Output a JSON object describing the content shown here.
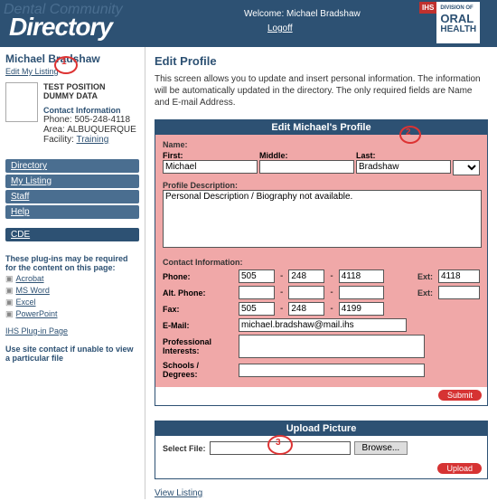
{
  "header": {
    "bg_text": "Dental Community",
    "title": "Directory",
    "welcome": "Welcome: Michael Bradshaw",
    "logoff": "Logoff",
    "logo": {
      "ihs": "IHS",
      "division": "DIVISION OF",
      "oral": "ORAL",
      "health": "HEALTH"
    }
  },
  "sidebar": {
    "name": "Michael Bradshaw",
    "edit_link": "Edit My Listing",
    "card": {
      "line1": "TEST POSITION",
      "line2": "DUMMY DATA",
      "contact_hdr": "Contact Information",
      "phone": "Phone: 505-248-4118",
      "area": "Area: ALBUQUERQUE",
      "facility_label": "Facility:",
      "facility_link": "Training"
    },
    "nav": [
      "Directory",
      "My Listing",
      "Staff",
      "Help"
    ],
    "cde": "CDE",
    "plugins_intro": "These plug-ins may be required for the content on this page:",
    "plugins": [
      "Acrobat",
      "MS Word",
      "Excel",
      "PowerPoint"
    ],
    "plugin_page": "IHS Plug-in Page",
    "nosite": "Use site contact if unable to view a particular file"
  },
  "main": {
    "heading": "Edit Profile",
    "intro": "This screen allows you to update and insert personal information. The information will be automatically updated in the directory. The only required fields are Name and E-mail Address.",
    "panel_title": "Edit Michael's Profile",
    "name_label": "Name:",
    "first_label": "First:",
    "middle_label": "Middle:",
    "last_label": "Last:",
    "first": "Michael",
    "middle": "",
    "last": "Bradshaw",
    "suffix": "",
    "profile_desc_label": "Profile Description:",
    "profile_desc": "Personal Description / Biography not available.",
    "contact_hdr": "Contact Information:",
    "phone_label": "Phone:",
    "phone": [
      "505",
      "248",
      "4118"
    ],
    "phone_ext_label": "Ext:",
    "phone_ext": "4118",
    "alt_label": "Alt. Phone:",
    "alt": [
      "",
      "",
      ""
    ],
    "alt_ext_label": "Ext:",
    "alt_ext": "",
    "fax_label": "Fax:",
    "fax": [
      "505",
      "248",
      "4199"
    ],
    "email_label": "E-Mail:",
    "email": "michael.bradshaw@mail.ihs",
    "interests_label": "Professional Interests:",
    "interests": "",
    "schools_label": "Schools / Degrees:",
    "schools": "",
    "submit": "Submit",
    "upload_title": "Upload Picture",
    "select_file_label": "Select File:",
    "file": "",
    "browse": "Browse...",
    "upload": "Upload",
    "view_listing": "View Listing"
  },
  "annotations": {
    "n1": "1",
    "n2": "2",
    "n3": "3"
  }
}
